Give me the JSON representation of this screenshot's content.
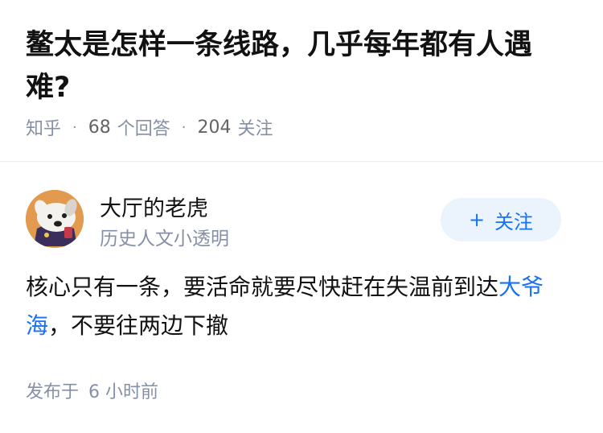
{
  "question": {
    "title": "鳌太是怎样一条线路，几乎每年都有人遇难?",
    "source": "知乎",
    "answers_count": "68",
    "answers_label": "个回答",
    "followers_count": "204",
    "followers_label": "关注"
  },
  "answer": {
    "author_name": "大厅的老虎",
    "author_badge": "历史人文小透明",
    "follow_button": "关注",
    "content_before": "核心只有一条，要活命就要尽快赶在失温前到达",
    "content_link": "大爷海",
    "content_after": "，不要往两边下撤",
    "time_prefix": "发布于",
    "time_value": "6 小时前"
  },
  "colors": {
    "accent": "#1772f6",
    "follow_bg": "#ebf3fd",
    "meta_gray": "#8590a6"
  },
  "icons": {
    "avatar": "dog-avatar-image",
    "follow": "plus-icon"
  }
}
